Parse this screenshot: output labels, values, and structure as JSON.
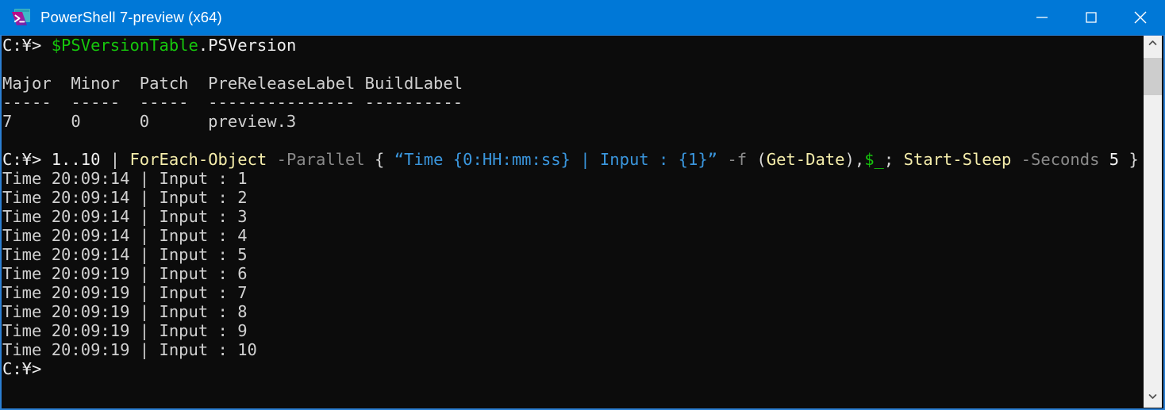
{
  "window": {
    "title": "PowerShell 7-preview (x64)",
    "icon": "powershell-icon",
    "titlebar_color": "#0078d7",
    "console_background": "#0c0c0c",
    "border_color": "#2b7fd3",
    "controls": {
      "minimize": "minimize-icon",
      "maximize": "maximize-icon",
      "close": "close-icon"
    }
  },
  "console": {
    "lines": [
      {
        "id": "prompt-1",
        "segments": [
          {
            "text": "C:¥> ",
            "color": "white"
          },
          {
            "text": "$PSVersionTable",
            "color": "green"
          },
          {
            "text": ".PSVersion",
            "color": "white"
          }
        ]
      },
      {
        "id": "blank-1",
        "segments": [
          {
            "text": " ",
            "color": "white"
          }
        ]
      },
      {
        "id": "table-header",
        "segments": [
          {
            "text": "Major  Minor  Patch  PreReleaseLabel BuildLabel",
            "color": "out"
          }
        ]
      },
      {
        "id": "table-rule",
        "segments": [
          {
            "text": "-----  -----  -----  --------------- ----------",
            "color": "out"
          }
        ]
      },
      {
        "id": "table-row-1",
        "segments": [
          {
            "text": "7      0      0      preview.3",
            "color": "out"
          }
        ]
      },
      {
        "id": "blank-2",
        "segments": [
          {
            "text": " ",
            "color": "white"
          }
        ]
      },
      {
        "id": "prompt-2",
        "segments": [
          {
            "text": "C:¥> ",
            "color": "white"
          },
          {
            "text": "1..10",
            "color": "num"
          },
          {
            "text": " ",
            "color": "white"
          },
          {
            "text": "|",
            "color": "op"
          },
          {
            "text": " ",
            "color": "white"
          },
          {
            "text": "ForEach-Object",
            "color": "cmdlet"
          },
          {
            "text": " ",
            "color": "white"
          },
          {
            "text": "-Parallel",
            "color": "gray"
          },
          {
            "text": " ",
            "color": "white"
          },
          {
            "text": "{",
            "color": "op"
          },
          {
            "text": " ",
            "color": "white"
          },
          {
            "text": "“Time {0:HH:mm:ss} | Input : {1}”",
            "color": "string"
          },
          {
            "text": " ",
            "color": "white"
          },
          {
            "text": "-f",
            "color": "gray"
          },
          {
            "text": " ",
            "color": "white"
          },
          {
            "text": "(",
            "color": "op"
          },
          {
            "text": "Get-Date",
            "color": "cmdlet"
          },
          {
            "text": ")",
            "color": "op"
          },
          {
            "text": ",",
            "color": "op"
          },
          {
            "text": "$_",
            "color": "green"
          },
          {
            "text": ";",
            "color": "op"
          },
          {
            "text": " ",
            "color": "white"
          },
          {
            "text": "Start-Sleep",
            "color": "cmdlet"
          },
          {
            "text": " ",
            "color": "white"
          },
          {
            "text": "-Seconds",
            "color": "gray"
          },
          {
            "text": " ",
            "color": "white"
          },
          {
            "text": "5",
            "color": "num"
          },
          {
            "text": " ",
            "color": "white"
          },
          {
            "text": "}",
            "color": "op"
          }
        ]
      },
      {
        "id": "out-1",
        "segments": [
          {
            "text": "Time 20:09:14 | Input : 1",
            "color": "out"
          }
        ]
      },
      {
        "id": "out-2",
        "segments": [
          {
            "text": "Time 20:09:14 | Input : 2",
            "color": "out"
          }
        ]
      },
      {
        "id": "out-3",
        "segments": [
          {
            "text": "Time 20:09:14 | Input : 3",
            "color": "out"
          }
        ]
      },
      {
        "id": "out-4",
        "segments": [
          {
            "text": "Time 20:09:14 | Input : 4",
            "color": "out"
          }
        ]
      },
      {
        "id": "out-5",
        "segments": [
          {
            "text": "Time 20:09:14 | Input : 5",
            "color": "out"
          }
        ]
      },
      {
        "id": "out-6",
        "segments": [
          {
            "text": "Time 20:09:19 | Input : 6",
            "color": "out"
          }
        ]
      },
      {
        "id": "out-7",
        "segments": [
          {
            "text": "Time 20:09:19 | Input : 7",
            "color": "out"
          }
        ]
      },
      {
        "id": "out-8",
        "segments": [
          {
            "text": "Time 20:09:19 | Input : 8",
            "color": "out"
          }
        ]
      },
      {
        "id": "out-9",
        "segments": [
          {
            "text": "Time 20:09:19 | Input : 9",
            "color": "out"
          }
        ]
      },
      {
        "id": "out-10",
        "segments": [
          {
            "text": "Time 20:09:19 | Input : 10",
            "color": "out"
          }
        ]
      },
      {
        "id": "prompt-3",
        "segments": [
          {
            "text": "C:¥>",
            "color": "white"
          }
        ]
      }
    ]
  },
  "scrollbar": {
    "up_arrow": "chevron-up-icon",
    "down_arrow": "chevron-down-icon",
    "thumb": "scrollbar-thumb"
  }
}
